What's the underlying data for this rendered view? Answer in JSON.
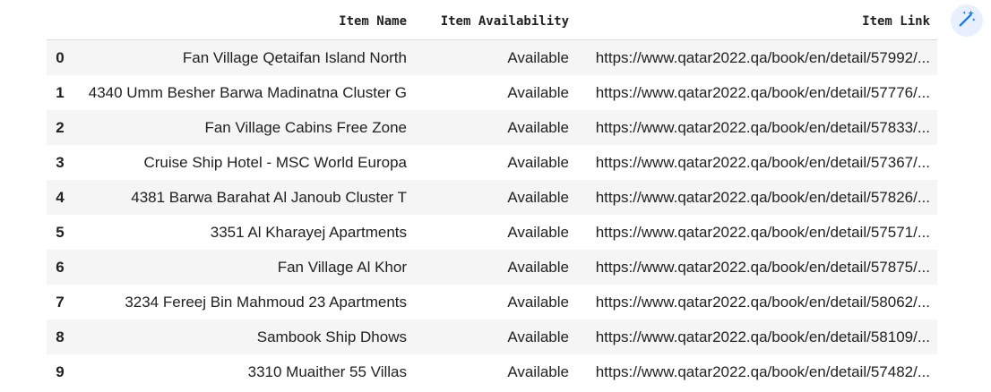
{
  "table": {
    "columns": [
      "Item Name",
      "Item Availability",
      "Item Link"
    ],
    "rows": [
      {
        "index": "0",
        "name": "Fan Village Qetaifan Island North",
        "availability": "Available",
        "link": "https://www.qatar2022.qa/book/en/detail/57992/..."
      },
      {
        "index": "1",
        "name": "4340 Umm Besher Barwa Madinatna Cluster G",
        "availability": "Available",
        "link": "https://www.qatar2022.qa/book/en/detail/57776/..."
      },
      {
        "index": "2",
        "name": "Fan Village Cabins Free Zone",
        "availability": "Available",
        "link": "https://www.qatar2022.qa/book/en/detail/57833/..."
      },
      {
        "index": "3",
        "name": "Cruise Ship Hotel - MSC World Europa",
        "availability": "Available",
        "link": "https://www.qatar2022.qa/book/en/detail/57367/..."
      },
      {
        "index": "4",
        "name": "4381 Barwa Barahat Al Janoub Cluster T",
        "availability": "Available",
        "link": "https://www.qatar2022.qa/book/en/detail/57826/..."
      },
      {
        "index": "5",
        "name": "3351 Al Kharayej Apartments",
        "availability": "Available",
        "link": "https://www.qatar2022.qa/book/en/detail/57571/..."
      },
      {
        "index": "6",
        "name": "Fan Village Al Khor",
        "availability": "Available",
        "link": "https://www.qatar2022.qa/book/en/detail/57875/..."
      },
      {
        "index": "7",
        "name": "3234 Fereej Bin Mahmoud 23 Apartments",
        "availability": "Available",
        "link": "https://www.qatar2022.qa/book/en/detail/58062/..."
      },
      {
        "index": "8",
        "name": "Sambook Ship Dhows",
        "availability": "Available",
        "link": "https://www.qatar2022.qa/book/en/detail/58109/..."
      },
      {
        "index": "9",
        "name": "3310 Muaither 55 Villas",
        "availability": "Available",
        "link": "https://www.qatar2022.qa/book/en/detail/57482/..."
      }
    ]
  },
  "toolbar": {
    "magic_icon": "magic-wand-icon",
    "accent_color": "#1a73e8",
    "button_bg": "#e8f0fe"
  },
  "colors": {
    "stripe": "#f5f5f5",
    "text": "#212121",
    "header_border": "#dadce0"
  }
}
